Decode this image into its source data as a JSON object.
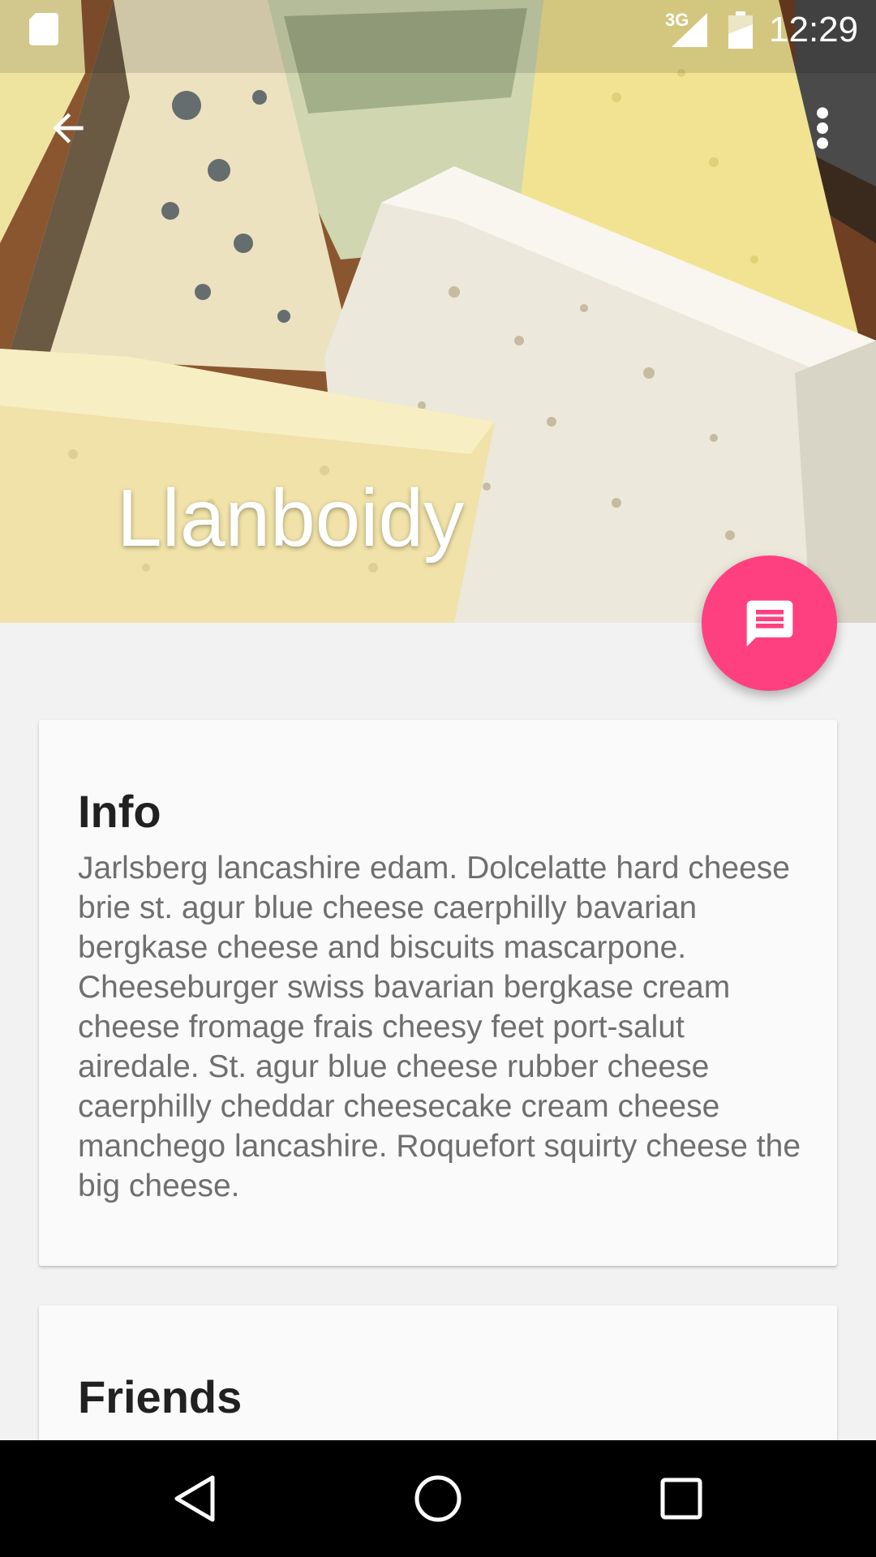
{
  "status_bar": {
    "network_type": "3G",
    "time": "12:29",
    "icons": [
      "sd-card-icon",
      "signal-icon",
      "battery-icon"
    ]
  },
  "toolbar": {
    "back_icon": "arrow-back-icon",
    "overflow_icon": "more-vert-icon"
  },
  "header": {
    "title": "Llanboidy",
    "image": "cheese-board-photo"
  },
  "fab": {
    "icon": "message-icon",
    "color": "#fe4081"
  },
  "cards": [
    {
      "title": "Info",
      "body": "Jarlsberg lancashire edam. Dolcelatte hard cheese brie st. agur blue cheese caerphilly bavarian bergkase cheese and biscuits mascarpone. Cheeseburger swiss bavarian bergkase cream cheese fromage frais cheesy feet port-salut airedale. St. agur blue cheese rubber cheese caerphilly cheddar cheesecake cream cheese manchego lancashire. Roquefort squirty cheese the big cheese."
    },
    {
      "title": "Friends"
    }
  ],
  "nav_bar": {
    "icons": [
      "nav-back-icon",
      "nav-home-icon",
      "nav-recents-icon"
    ]
  }
}
